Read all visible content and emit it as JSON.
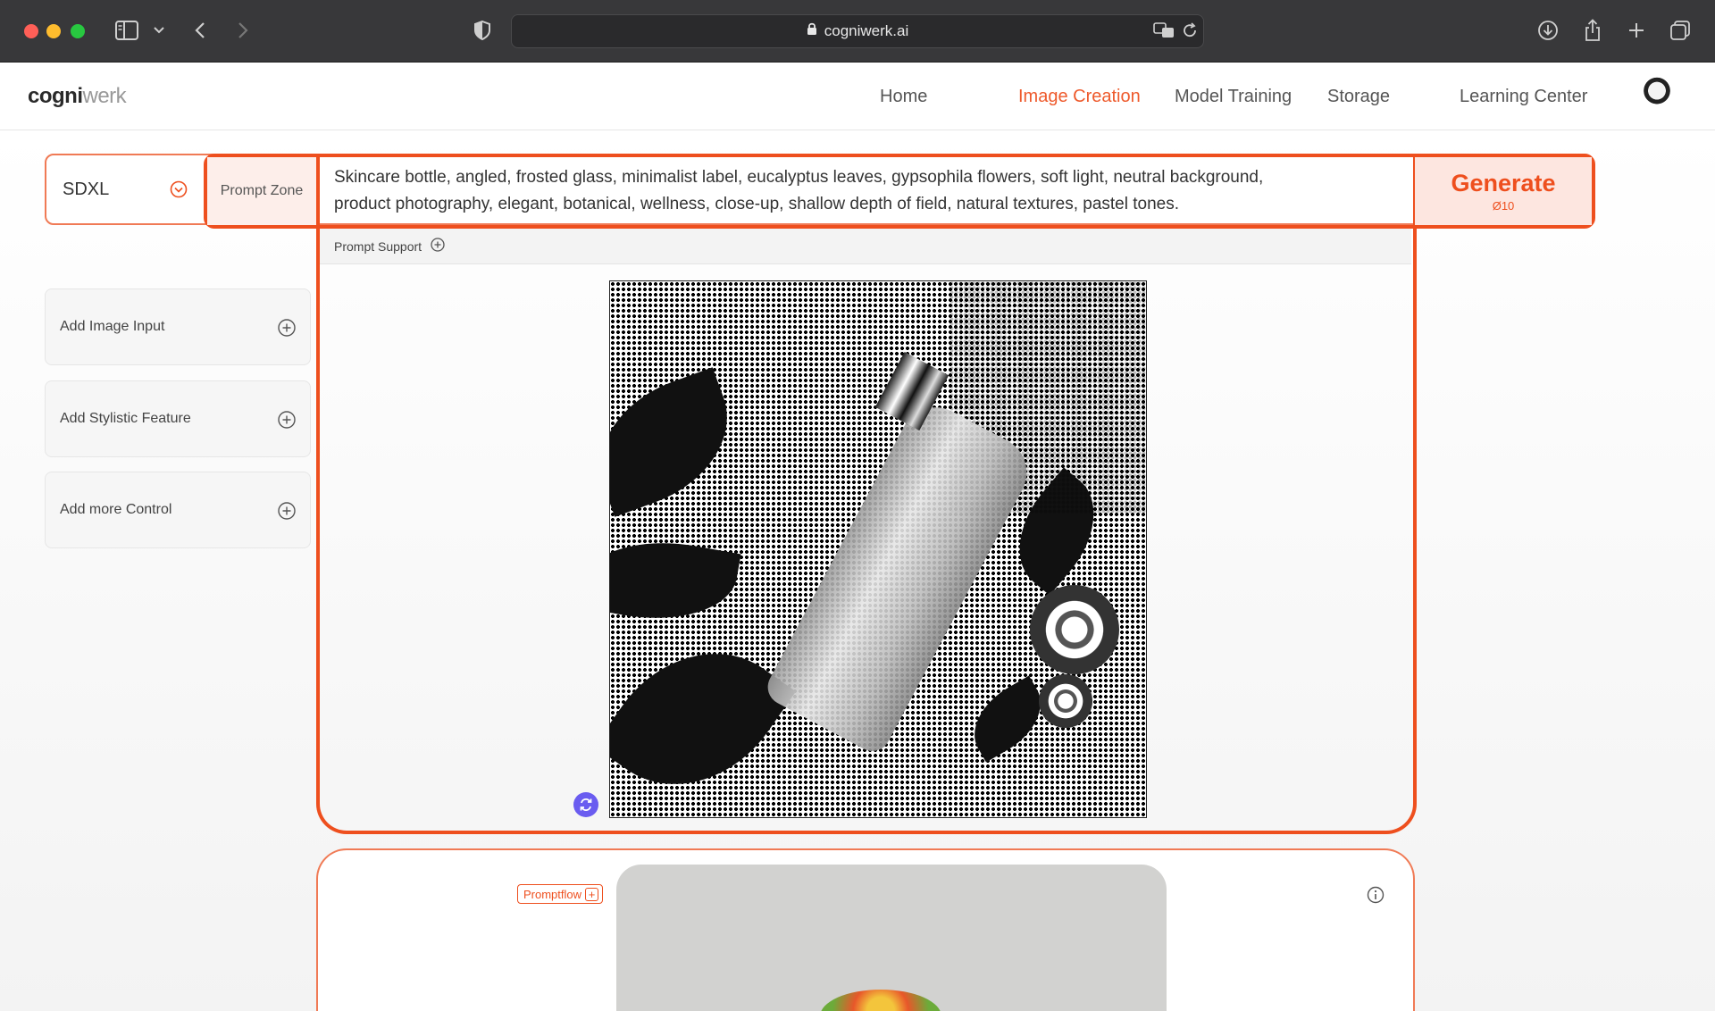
{
  "browser": {
    "url": "cogniwerk.ai"
  },
  "app": {
    "logo_bold": "cogni",
    "logo_light": "werk",
    "nav": [
      {
        "label": "Home"
      },
      {
        "label": "Image Creation",
        "active": true
      },
      {
        "label": "Model Training"
      },
      {
        "label": "Storage"
      },
      {
        "label": "Learning Center"
      }
    ]
  },
  "prompt": {
    "model": "SDXL",
    "zone_label": "Prompt Zone",
    "text_line1": "Skincare bottle, angled, frosted glass, minimalist label, eucalyptus leaves, gypsophila flowers, soft light, neutral background,",
    "text_line2": "product photography, elegant, botanical, wellness, close-up, shallow depth of field, natural textures, pastel tones.",
    "generate_label": "Generate",
    "generate_cost": "Ø10",
    "support_label": "Prompt Support"
  },
  "sidebar": {
    "items": [
      {
        "label": "Add Image Input"
      },
      {
        "label": "Add Stylistic Feature"
      },
      {
        "label": "Add more Control"
      }
    ]
  },
  "flow": {
    "label": "Promptflow",
    "plus": "+"
  },
  "colors": {
    "accent": "#ee4f1e",
    "generate_bg": "#fde6e0",
    "regen": "#6a5cf0"
  },
  "icons": [
    "sidebar-icon",
    "chevron-down-icon",
    "back-icon",
    "forward-icon",
    "shield-icon",
    "lock-icon",
    "translate-icon",
    "reload-icon",
    "download-icon",
    "share-icon",
    "new-tab-icon",
    "tabs-icon",
    "plus-circle-icon",
    "regenerate-icon",
    "info-icon"
  ]
}
